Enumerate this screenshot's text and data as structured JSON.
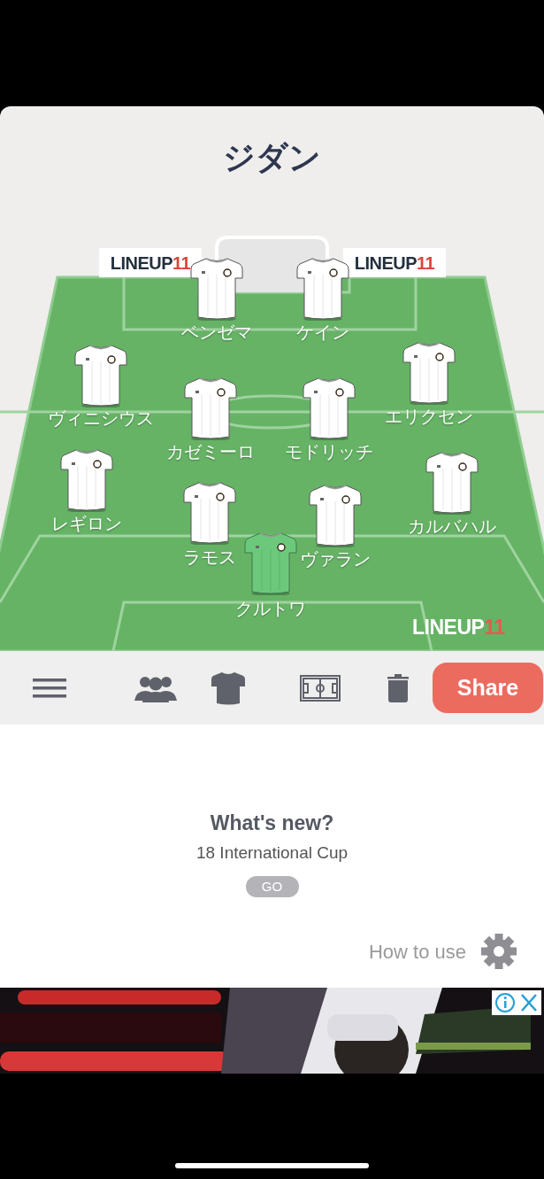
{
  "team": {
    "title": "ジダン"
  },
  "boards": [
    {
      "word": "LINEUP",
      "number": "11"
    },
    {
      "word": "LINEUP",
      "number": "11"
    },
    {
      "word": "LINEUP",
      "number": "11"
    }
  ],
  "players": [
    {
      "name": "ベンゼマ",
      "kind": "outfield"
    },
    {
      "name": "ケイン",
      "kind": "outfield"
    },
    {
      "name": "ヴィニシウス",
      "kind": "outfield"
    },
    {
      "name": "カゼミーロ",
      "kind": "outfield"
    },
    {
      "name": "モドリッチ",
      "kind": "outfield"
    },
    {
      "name": "エリクセン",
      "kind": "outfield"
    },
    {
      "name": "レギロン",
      "kind": "outfield"
    },
    {
      "name": "ラモス",
      "kind": "outfield"
    },
    {
      "name": "ヴァラン",
      "kind": "outfield"
    },
    {
      "name": "カルバハル",
      "kind": "outfield"
    },
    {
      "name": "クルトワ",
      "kind": "goalkeeper"
    }
  ],
  "toolbar": {
    "share": "Share"
  },
  "news": {
    "heading": "What's new?",
    "text": "18 International Cup",
    "button": "GO"
  },
  "help": {
    "label": "How to use"
  }
}
